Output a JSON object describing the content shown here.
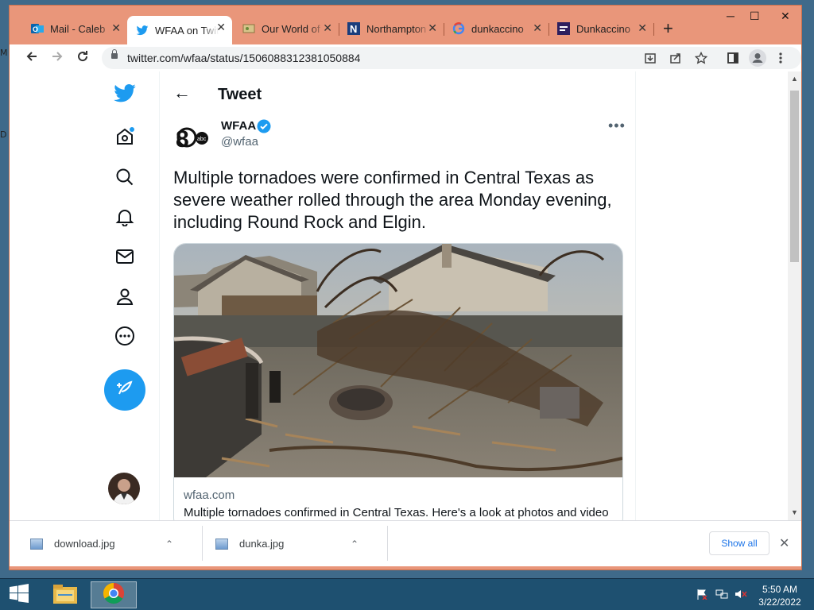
{
  "desktop": {
    "frag_top": "M",
    "frag_mid": "D"
  },
  "window": {
    "controls": {
      "minimize": "─",
      "maximize": "☐",
      "close": "✕"
    }
  },
  "tabs": [
    {
      "title": "Mail - Caleb",
      "icon": "outlook-icon"
    },
    {
      "title": "WFAA on Twitter",
      "icon": "twitter-icon",
      "active": true
    },
    {
      "title": "Our World of",
      "icon": "map-icon"
    },
    {
      "title": "Northampton",
      "icon": "n-logo-icon"
    },
    {
      "title": "dunkaccino",
      "icon": "google-icon"
    },
    {
      "title": "Dunkaccino",
      "icon": "dunkin-icon"
    }
  ],
  "tab_close": "✕",
  "new_tab": "+",
  "toolbar": {
    "url": "twitter.com/wfaa/status/1506088312381050884"
  },
  "tweet": {
    "header": "Tweet",
    "back": "←",
    "name": "WFAA",
    "handle": "@wfaa",
    "more": "•••",
    "text": "Multiple tornadoes were confirmed in Central Texas as severe weather rolled through the area Monday evening, including Round Rock and Elgin.",
    "card_domain": "wfaa.com",
    "card_title": "Multiple tornadoes confirmed in Central Texas. Here's a look at photos and video"
  },
  "downloads": {
    "items": [
      {
        "name": "download.jpg"
      },
      {
        "name": "dunka.jpg"
      }
    ],
    "chevron": "⌃",
    "show_all": "Show all",
    "close": "✕"
  },
  "taskbar": {
    "time": "5:50 AM",
    "date": "3/22/2022"
  },
  "colors": {
    "twitter_blue": "#1d9bf0",
    "frame": "#e9967a",
    "taskbar": "#1e5070"
  }
}
